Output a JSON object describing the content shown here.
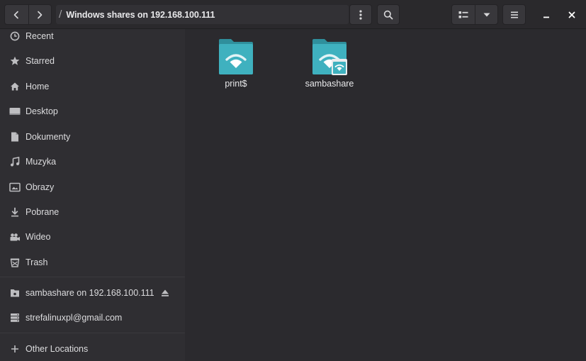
{
  "window": {
    "location_label": "Windows shares on 192.168.100.111",
    "path_separator": "/"
  },
  "sidebar": {
    "places": [
      {
        "label": "Recent",
        "icon": "clock-icon"
      },
      {
        "label": "Starred",
        "icon": "star-icon"
      },
      {
        "label": "Home",
        "icon": "home-icon"
      },
      {
        "label": "Desktop",
        "icon": "desktop-icon"
      },
      {
        "label": "Dokumenty",
        "icon": "document-icon"
      },
      {
        "label": "Muzyka",
        "icon": "music-icon"
      },
      {
        "label": "Obrazy",
        "icon": "picture-icon"
      },
      {
        "label": "Pobrane",
        "icon": "download-icon"
      },
      {
        "label": "Wideo",
        "icon": "video-icon"
      },
      {
        "label": "Trash",
        "icon": "trash-icon"
      }
    ],
    "mounts": [
      {
        "label": "sambashare on 192.168.100.111",
        "icon": "network-folder-icon",
        "ejectable": true
      },
      {
        "label": "strefalinuxpl@gmail.com",
        "icon": "online-account-icon"
      }
    ],
    "other": {
      "label": "Other Locations",
      "icon": "plus-icon"
    }
  },
  "files": [
    {
      "name": "print$",
      "icon": "network-share-folder-icon"
    },
    {
      "name": "sambashare",
      "icon": "mounted-network-share-folder-icon"
    }
  ],
  "colors": {
    "folder_teal": "#3fb1bf",
    "folder_teal_dark": "#2f8f9c",
    "background": "#2b2a2e",
    "sidebar": "#2f2e32"
  }
}
